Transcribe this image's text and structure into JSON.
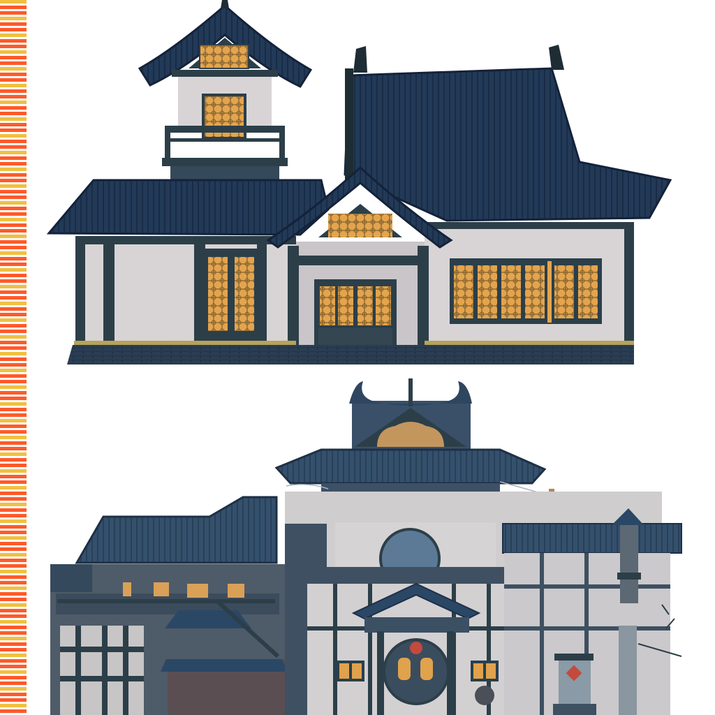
{
  "sheet": {
    "assets": [
      {
        "name": "teahouse-with-watchtower",
        "kind": "building-facade"
      },
      {
        "name": "bathhouse-complex",
        "kind": "building-facade"
      }
    ]
  },
  "palette": {
    "background": "#ffffff",
    "roof_dark": "#1f3552",
    "roof_mid": "#2b4766",
    "roof_light": "#3d5d80",
    "beam": "#2c3f49",
    "beam_dark": "#1e2c34",
    "wall": "#d8d4d6",
    "wall_shade": "#c9c5c8",
    "lit_window": "#e4a44e",
    "lit_window_glow": "#f2bd6a",
    "lattice": "#5a4a2a",
    "plinth": "#27394d",
    "muted_wall": "#8e97a2",
    "dark_wall": "#4b5a6a",
    "stripe_warm": "#ff5a2a",
    "stripe_gold": "#f0c040"
  }
}
